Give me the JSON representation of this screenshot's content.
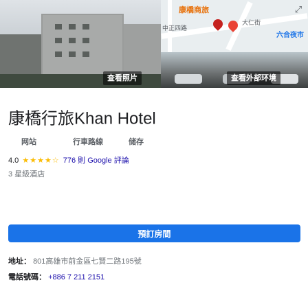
{
  "map": {
    "label_hotel": "康橋商旅",
    "label_street": "大仁街",
    "label_market": "六合夜市",
    "label_road": "中正四路"
  },
  "photos": {
    "see_photos": "查看照片",
    "see_outside": "查看外部环境"
  },
  "hotel": {
    "title": "康橋行旅Khan Hotel",
    "actions": [
      {
        "label": "网站"
      },
      {
        "label": "行車路線"
      },
      {
        "label": "储存"
      }
    ],
    "rating": "4.0",
    "stars": "★★★★☆",
    "reviews": "776 則 Google 評論",
    "hotel_class": "3 星級酒店"
  },
  "booking": {
    "button_label": "預訂房間"
  },
  "address": {
    "key": "地址：",
    "value": "801高雄市前金區七賢二路195號"
  },
  "phone": {
    "key": "電話號碼：",
    "value": "+886 7 211 2151"
  },
  "colors": {
    "accent": "#1a73e8",
    "link": "#1a0dab",
    "star": "#fbbc04"
  }
}
